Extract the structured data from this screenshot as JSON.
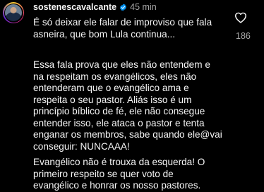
{
  "comment": {
    "username": "sostenescavalcante",
    "timestamp": "45 min",
    "paragraphs": [
      "É só deixar ele falar de improviso que fala\nasneira, que bom Lula continua...",
      "Essa fala prova que eles não entendem e\nna respeitam os evangélicos, eles não\nentenderam que o evangélico ama e\nrespeita o seu pastor. Aliás isso é um\nprincípio bíblico de fé, ele não consegue\nentender isso, ele ataca o pastor e tenta\nenganar os membros, sabe quando ele@vai\nconseguir: NUNCAAA!",
      "Evangélico não é trouxa da esquerda! O\nprimeiro respeito se quer voto de\nevangélico e honrar os nosso pastores."
    ],
    "like_count": "186",
    "icons": {
      "avatar": "avatar",
      "verified": "verified-badge-icon",
      "like": "heart-outline-icon"
    },
    "colors": {
      "background": "#000000",
      "text": "#f5f5f5",
      "muted": "#a8a8a8",
      "verified": "#0095f6"
    }
  }
}
